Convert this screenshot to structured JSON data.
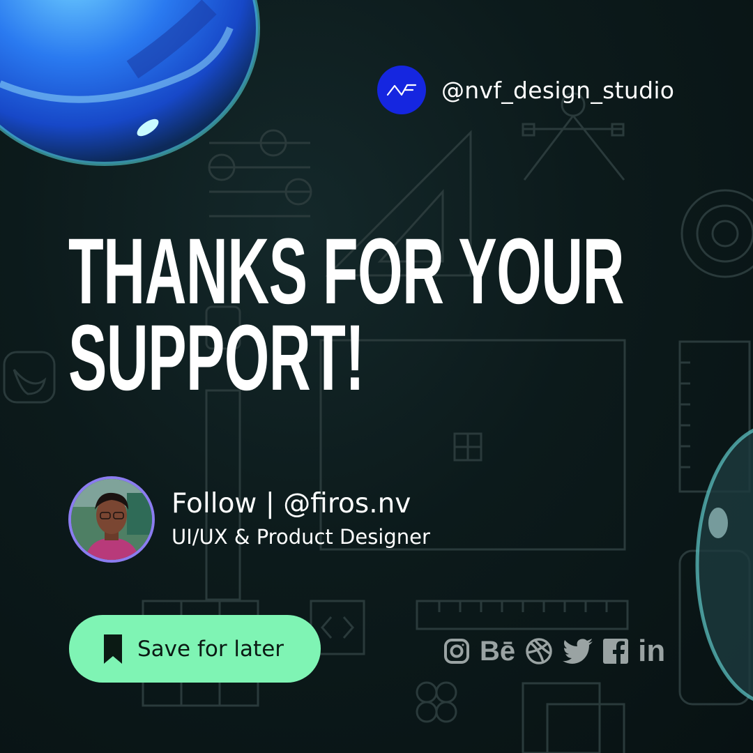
{
  "brand": {
    "handle": "@nvf_design_studio",
    "logo_icon": "nvf-logo-icon",
    "logo_color": "#1526e0"
  },
  "headline": {
    "line1": "THANKS FOR YOUR",
    "line2": "SUPPORT!"
  },
  "profile": {
    "follow_text": "Follow | @firos.nv",
    "role": "UI/UX & Product Designer",
    "avatar_icon": "profile-photo"
  },
  "cta": {
    "save_label": "Save for later",
    "icon": "bookmark-icon",
    "color": "#7ff4b4"
  },
  "socials": [
    {
      "name": "instagram",
      "icon": "instagram-icon"
    },
    {
      "name": "behance",
      "icon": "behance-icon",
      "text": "Bē"
    },
    {
      "name": "dribbble",
      "icon": "dribbble-icon"
    },
    {
      "name": "twitter",
      "icon": "twitter-icon"
    },
    {
      "name": "facebook",
      "icon": "facebook-icon"
    },
    {
      "name": "linkedin",
      "icon": "linkedin-icon",
      "text": "in"
    }
  ],
  "colors": {
    "background": "#0c1a1b",
    "text": "#ffffff",
    "social_icons": "#9aa3a3",
    "avatar_ring": "#8b7cf0"
  }
}
